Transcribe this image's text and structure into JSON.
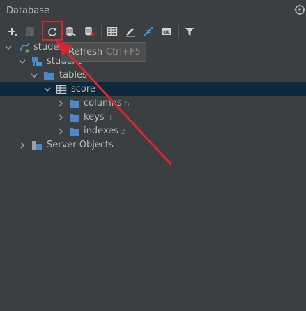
{
  "panel": {
    "title": "Database"
  },
  "toolbar": {
    "icons": [
      {
        "name": "add-icon"
      },
      {
        "name": "duplicate-icon"
      },
      {
        "name": "refresh-icon"
      },
      {
        "name": "data-source-properties-icon"
      },
      {
        "name": "disconnect-icon"
      },
      {
        "name": "table-editor-icon"
      },
      {
        "name": "edit-icon"
      },
      {
        "name": "jump-to-source-icon"
      },
      {
        "name": "sql-console-icon"
      },
      {
        "name": "filter-icon"
      }
    ]
  },
  "tooltip": {
    "label": "Refresh",
    "shortcut": "Ctrl+F5"
  },
  "tree": {
    "datasource": {
      "label": "studen"
    },
    "schema": {
      "label": "student"
    },
    "tables": {
      "label": "tables",
      "count": "1"
    },
    "score": {
      "label": "score"
    },
    "columns": {
      "label": "columns",
      "count": "5"
    },
    "keys": {
      "label": "keys",
      "count": "1"
    },
    "indexes": {
      "label": "indexes",
      "count": "2"
    },
    "server_objects": {
      "label": "Server Objects"
    }
  },
  "colors": {
    "background": "#3c3f41",
    "selection": "#0d293e",
    "annotation_red": "#e0242b",
    "folder_blue": "#4a88c7"
  }
}
